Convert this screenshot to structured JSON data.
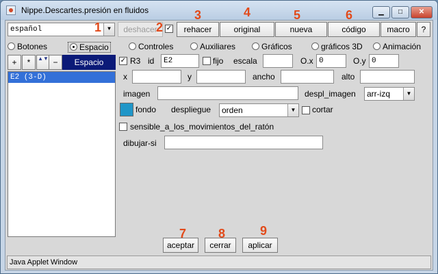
{
  "window": {
    "title": "Nippe.Descartes.presión en fluidos",
    "minimize_label": "▁",
    "maximize_label": "□",
    "close_label": "✕"
  },
  "toolbar": {
    "language": "español",
    "undo_label": "deshacer",
    "redo_label": "rehacer",
    "original_label": "original",
    "new_label": "nueva",
    "code_label": "código",
    "macro_label": "macro",
    "help_label": "?"
  },
  "annotations": [
    "1",
    "2",
    "3",
    "4",
    "5",
    "6",
    "7",
    "8",
    "9"
  ],
  "tabs": [
    {
      "label": "Botones",
      "selected": false
    },
    {
      "label": "Espacio",
      "selected": true
    },
    {
      "label": "Controles",
      "selected": false
    },
    {
      "label": "Auxiliares",
      "selected": false
    },
    {
      "label": "Gráficos",
      "selected": false
    },
    {
      "label": "gráficos 3D",
      "selected": false
    },
    {
      "label": "Animación",
      "selected": false
    }
  ],
  "space_panel": {
    "add_label": "+",
    "star_label": "*",
    "updown_label": "▲▼",
    "remove_label": "−",
    "header": "Espacio",
    "items": [
      "E2 (3-D)"
    ]
  },
  "form": {
    "r3_label": "R3",
    "r3_checked": true,
    "id_label": "id",
    "id_value": "E2",
    "fijo_label": "fijo",
    "escala_label": "escala",
    "escala_value": "",
    "ox_label": "O.x",
    "ox_value": "0",
    "oy_label": "O.y",
    "oy_value": "0",
    "x_label": "x",
    "x_value": "",
    "y_label": "y",
    "y_value": "",
    "ancho_label": "ancho",
    "ancho_value": "",
    "alto_label": "alto",
    "alto_value": "",
    "imagen_label": "imagen",
    "imagen_value": "",
    "despl_label": "despl_imagen",
    "despl_value": "arr-izq",
    "fondo_label": "fondo",
    "fondo_color": "#1f96c8",
    "despliegue_label": "despliegue",
    "despliegue_value": "orden",
    "cortar_label": "cortar",
    "sensible_label": "sensible_a_los_movimientos_del_ratón",
    "dibujar_label": "dibujar-si",
    "dibujar_value": ""
  },
  "bottom": {
    "accept_label": "aceptar",
    "close_label": "cerrar",
    "apply_label": "aplicar"
  },
  "status": "Java Applet Window"
}
